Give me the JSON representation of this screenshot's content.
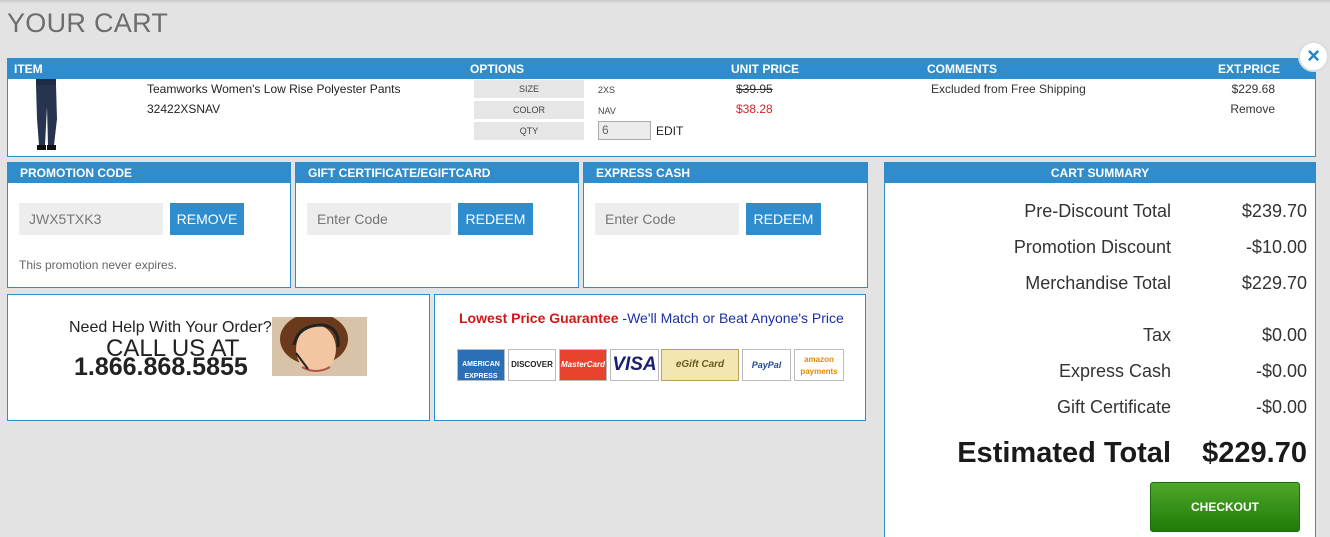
{
  "page_title": "YOUR CART",
  "close_label": "×",
  "items_table": {
    "headers": {
      "item": "ITEM",
      "options": "OPTIONS",
      "unit_price": "UNIT PRICE",
      "comments": "COMMENTS",
      "ext_price": "EXT.PRICE"
    },
    "row": {
      "name": "Teamworks Women's Low Rise Polyester Pants",
      "sku": "32422XSNAV",
      "options": [
        {
          "label": "SIZE",
          "value": "2XS"
        },
        {
          "label": "COLOR",
          "value": "NAV"
        },
        {
          "label": "QTY",
          "value": "6"
        }
      ],
      "edit_label": "EDIT",
      "original_price": "$39.95",
      "sale_price": "$38.28",
      "comment": "Excluded from Free Shipping",
      "ext_price": "$229.68",
      "remove_label": "Remove"
    }
  },
  "promotion": {
    "title": "PROMOTION CODE",
    "code": "JWX5TXK3",
    "button": "REMOVE",
    "note": "This promotion never expires."
  },
  "gift": {
    "title": "GIFT CERTIFICATE/EGIFTCARD",
    "placeholder": "Enter Code",
    "button": "REDEEM"
  },
  "express_cash": {
    "title": "EXPRESS CASH",
    "placeholder": "Enter Code",
    "button": "REDEEM"
  },
  "help": {
    "question": "Need Help With Your Order?",
    "call": "CALL US AT",
    "phone": "1.866.868.5855"
  },
  "guarantee": {
    "headline": "Lowest Price Guarantee",
    "tagline": "-We'll Match or Beat Anyone's Price",
    "cards": [
      "AMERICAN EXPRESS",
      "DISCOVER",
      "MasterCard",
      "VISA",
      "eGift Card",
      "PayPal",
      "amazon payments"
    ]
  },
  "summary": {
    "title": "CART SUMMARY",
    "rows": [
      {
        "label": "Pre-Discount Total",
        "value": "$239.70"
      },
      {
        "label": "Promotion Discount",
        "value": "-$10.00"
      },
      {
        "label": "Merchandise Total",
        "value": "$229.70"
      },
      {
        "label": "Tax",
        "value": "$0.00"
      },
      {
        "label": "Express Cash",
        "value": "-$0.00"
      },
      {
        "label": "Gift Certificate",
        "value": "-$0.00"
      }
    ],
    "estimated_label": "Estimated Total",
    "estimated_value": "$229.70",
    "checkout": "CHECKOUT"
  },
  "colors": {
    "accent": "#2f8dce",
    "sale_red": "#d4262c",
    "checkout_green": "#2e8f14"
  }
}
